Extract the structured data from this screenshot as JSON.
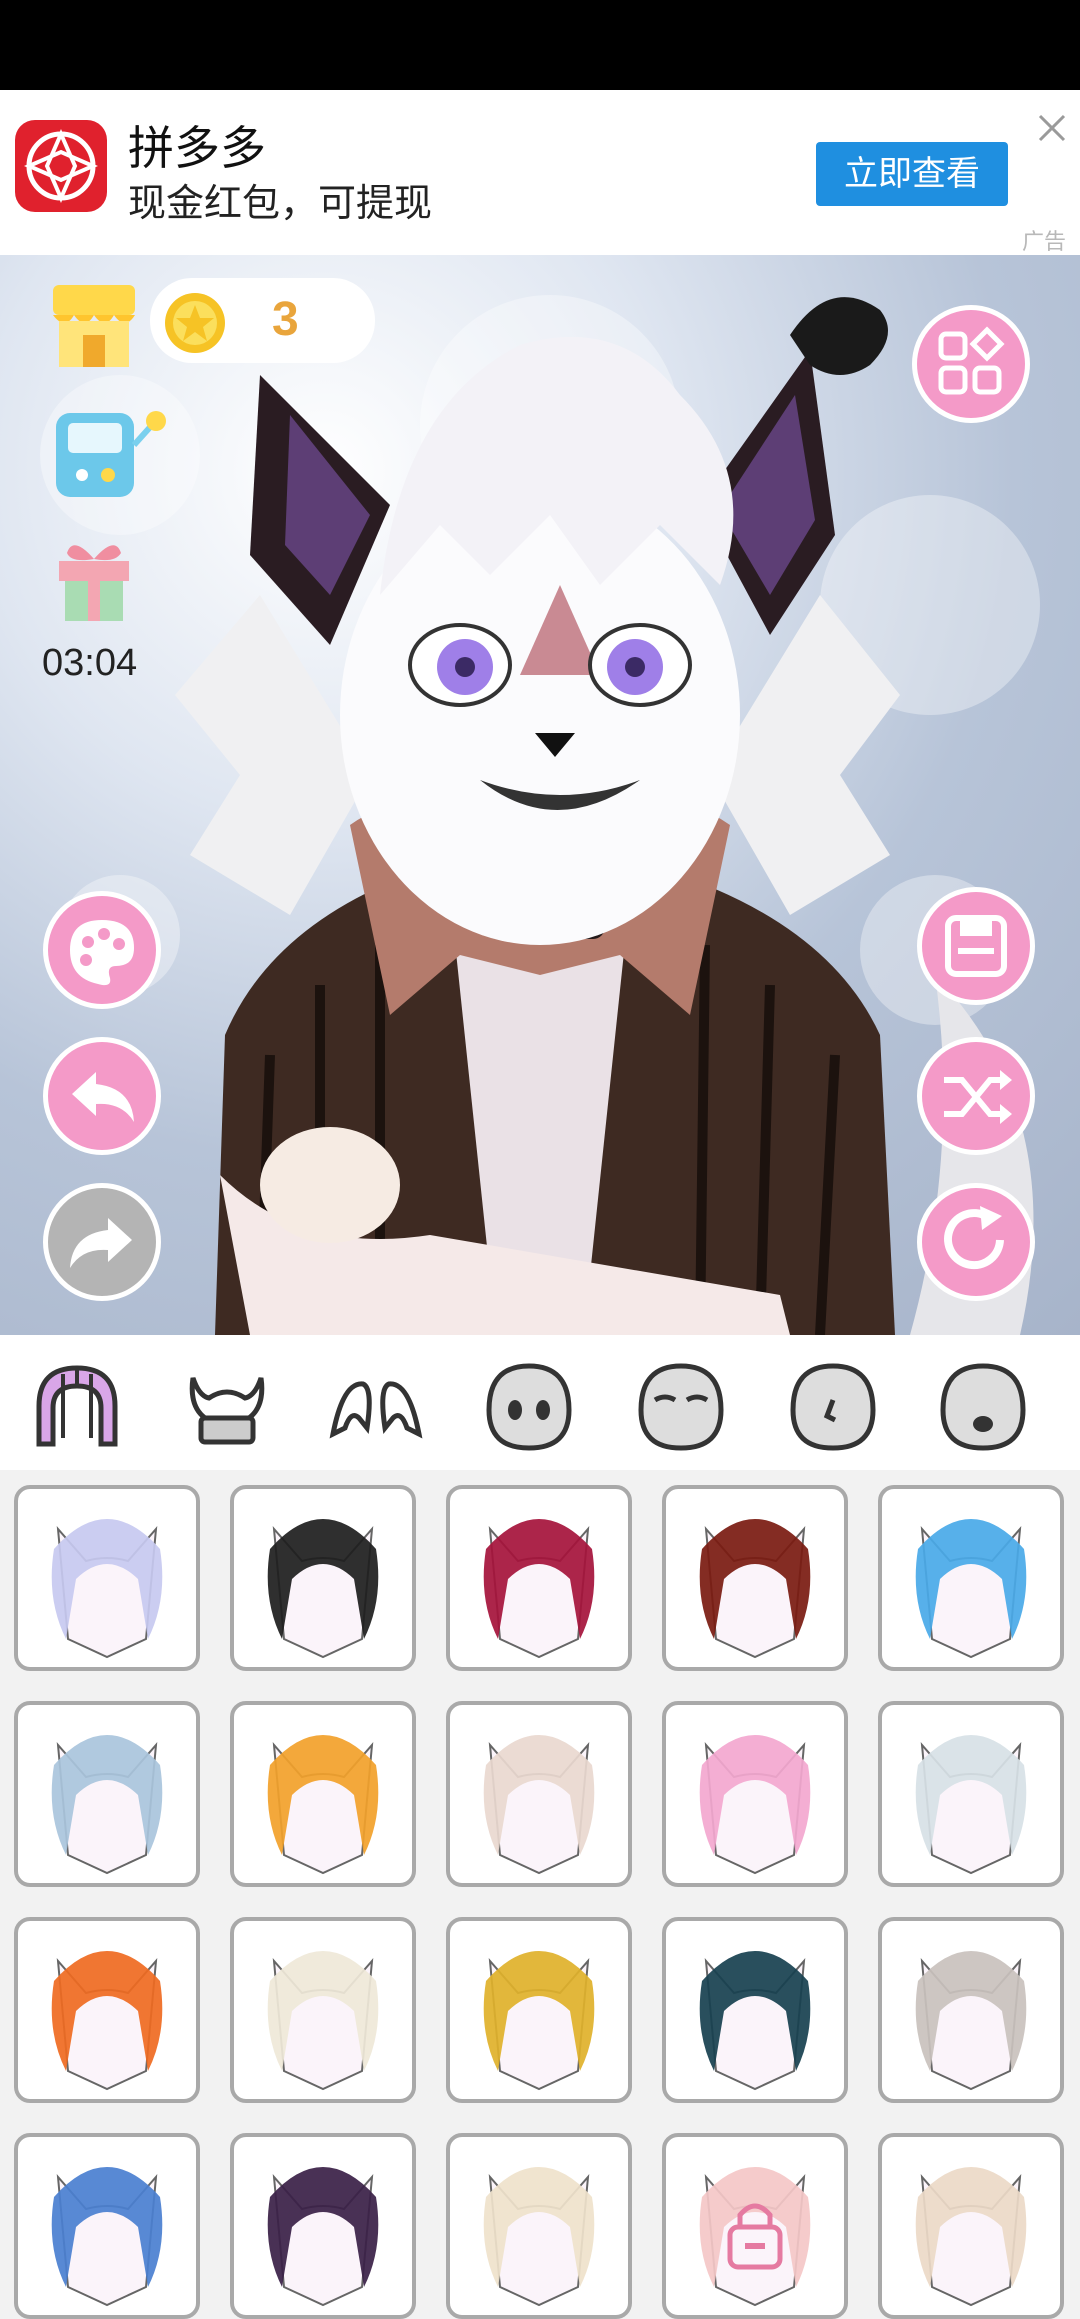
{
  "ad": {
    "title": "拼多多",
    "subtitle": "现金红包，可提现",
    "button_label": "立即查看",
    "ad_mark": "广告",
    "brand_color": "#e0212d",
    "button_color": "#1f8fe0"
  },
  "hud": {
    "coin_count": "3",
    "timer": "03:04",
    "accent_color": "#f49ac8"
  },
  "left_tools": [
    "shop-icon",
    "gacha-machine-icon",
    "gift-icon",
    "palette-icon",
    "undo-icon",
    "redo-icon"
  ],
  "right_tools": [
    "menu-grid-icon",
    "save-icon",
    "shuffle-icon",
    "reset-icon"
  ],
  "tabs": [
    "hair",
    "horns",
    "ears",
    "face-1",
    "face-2",
    "face-3",
    "face-4"
  ],
  "selected_tab": "hair",
  "hair_items": [
    {
      "color": "#c7c9f0"
    },
    {
      "color": "#1d1d1d"
    },
    {
      "color": "#a5123b"
    },
    {
      "color": "#7a1a10"
    },
    {
      "color": "#49a9e8"
    },
    {
      "color": "#a9c4dc"
    },
    {
      "color": "#f2a12a"
    },
    {
      "color": "#e9d8cf"
    },
    {
      "color": "#f3a7cf"
    },
    {
      "color": "#d7e1e6"
    },
    {
      "color": "#ef6a21"
    },
    {
      "color": "#efe8d8"
    },
    {
      "color": "#e0b12a"
    },
    {
      "color": "#17404f"
    },
    {
      "color": "#c9c1bd"
    },
    {
      "color": "#4a7fd0"
    },
    {
      "color": "#3a1f47"
    },
    {
      "color": "#efe2cb"
    },
    {
      "color": "#f4c7c7",
      "locked": true
    },
    {
      "color": "#ecd9c7"
    }
  ]
}
